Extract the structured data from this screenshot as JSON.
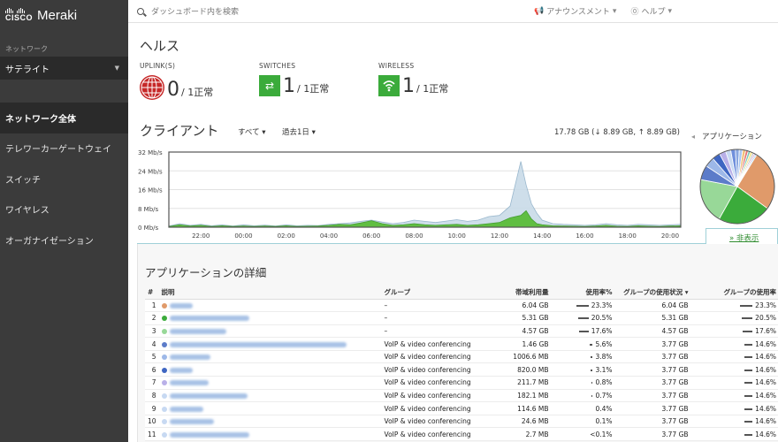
{
  "brand": {
    "cisco": "CISCO",
    "product": "Meraki"
  },
  "sidebar": {
    "section_label": "ネットワーク",
    "network": "サテライト",
    "items": [
      {
        "label": "ネットワーク全体",
        "active": true
      },
      {
        "label": "テレワーカーゲートウェイ",
        "active": false
      },
      {
        "label": "スイッチ",
        "active": false
      },
      {
        "label": "ワイヤレス",
        "active": false
      },
      {
        "label": "オーガナイゼーション",
        "active": false
      }
    ]
  },
  "topbar": {
    "search_placeholder": "ダッシュボード内を検索",
    "announcement": "アナウンスメント",
    "help": "ヘルプ"
  },
  "health": {
    "title": "ヘルス",
    "stats": [
      {
        "label": "UPLINK(S)",
        "count": "0",
        "detail": "/ 1正常",
        "icon": "globe-icon",
        "color": "#c62828"
      },
      {
        "label": "SWITCHES",
        "count": "1",
        "detail": "/ 1正常",
        "icon": "switch-icon",
        "color": "#3bab3b"
      },
      {
        "label": "WIRELESS",
        "count": "1",
        "detail": "/ 1正常",
        "icon": "wifi-icon",
        "color": "#3bab3b"
      }
    ]
  },
  "clients": {
    "title": "クライアント",
    "filter_all": "すべて",
    "filter_range": "過去1日",
    "usage_summary": "17.78 GB (↓ 8.89 GB, ↑ 8.89 GB)",
    "applications_label": "アプリケーション",
    "hide_link": "» 非表示"
  },
  "chart_data": {
    "type": "area",
    "y_ticks": [
      "32 Mb/s",
      "24 Mb/s",
      "16 Mb/s",
      "8 Mb/s",
      "0 Mb/s"
    ],
    "ylim": [
      0,
      32
    ],
    "x_ticks": [
      "22:00",
      "00:00",
      "02:00",
      "04:00",
      "06:00",
      "08:00",
      "10:00",
      "12:00",
      "14:00",
      "16:00",
      "18:00",
      "20:00"
    ],
    "x_hours": [
      20.5,
      21,
      21.5,
      22,
      22.5,
      23,
      23.5,
      24,
      24.5,
      25,
      25.5,
      26,
      26.5,
      27,
      27.5,
      28,
      28.5,
      29,
      29.5,
      30,
      30.5,
      31,
      31.5,
      32,
      32.5,
      33,
      33.5,
      34,
      34.5,
      35,
      35.5,
      36,
      36.5,
      37,
      37.25,
      37.5,
      37.75,
      38,
      38.5,
      39,
      39.5,
      40,
      40.5,
      41,
      41.5,
      42,
      42.5,
      43,
      43.5,
      44,
      44.5
    ],
    "series": [
      {
        "values": [
          0.5,
          1.5,
          0.8,
          1.2,
          0.6,
          1.0,
          0.5,
          1.0,
          0.6,
          0.9,
          0.5,
          1.0,
          0.6,
          0.8,
          0.7,
          1.2,
          1.5,
          1.8,
          2.5,
          3.0,
          2.2,
          1.5,
          2.0,
          3.0,
          2.5,
          2.0,
          2.6,
          3.2,
          2.5,
          3.0,
          4.5,
          5.0,
          9.0,
          28.0,
          18.0,
          10.0,
          6.0,
          3.0,
          1.5,
          1.2,
          1.0,
          0.8,
          1.0,
          1.5,
          1.0,
          0.8,
          1.2,
          1.0,
          0.8,
          1.0,
          1.2
        ]
      },
      {
        "values": [
          0.3,
          1.0,
          0.5,
          0.8,
          0.3,
          0.6,
          0.3,
          0.5,
          0.3,
          0.5,
          0.3,
          0.6,
          0.3,
          0.4,
          0.5,
          0.8,
          1.2,
          1.0,
          1.8,
          2.8,
          1.5,
          0.8,
          1.0,
          1.5,
          1.0,
          0.8,
          1.0,
          1.2,
          0.8,
          1.0,
          1.5,
          2.0,
          4.0,
          5.0,
          7.0,
          3.5,
          1.5,
          1.0,
          0.6,
          0.5,
          0.4,
          0.3,
          0.5,
          0.8,
          0.4,
          0.3,
          0.6,
          0.4,
          0.3,
          0.5,
          0.6
        ]
      }
    ],
    "colors": [
      "#c9dbe8",
      "#5bbd3a"
    ]
  },
  "pie_data": {
    "type": "pie",
    "values": [
      23.3,
      20.5,
      17.6,
      5.6,
      3.8,
      3.1,
      2.5,
      2.0,
      1.8,
      1.5,
      1.3,
      1.2,
      1.0,
      0.9,
      0.8,
      0.7,
      0.6,
      0.5
    ],
    "colors": [
      "#e09a6a",
      "#3bab3b",
      "#98d898",
      "#5c7cc9",
      "#9db8e8",
      "#3f66c2",
      "#b9b0e8",
      "#c7d9f2",
      "#6f8fdc",
      "#88a6e0",
      "#a9c6f0",
      "#f0c07a",
      "#e57373",
      "#7ac7b8",
      "#f2e27a",
      "#c0c0c0",
      "#d6a6d6",
      "#8fd0f0"
    ]
  },
  "details": {
    "title": "アプリケーションの詳細",
    "headers": [
      "#",
      "説明",
      "グループ",
      "帯域利用量",
      "使用率%",
      "グループの使用状況 ▾",
      "グループの使用率"
    ],
    "rows": [
      {
        "n": "1",
        "color": "#e09a6a",
        "w": 26,
        "group": "–",
        "usage": "6.04 GB",
        "pct": "23.3%",
        "bar": 14,
        "gusage": "6.04 GB",
        "gpct": "23.3%",
        "gbar": 14
      },
      {
        "n": "2",
        "color": "#3bab3b",
        "w": 90,
        "group": "–",
        "usage": "5.31 GB",
        "pct": "20.5%",
        "bar": 12,
        "gusage": "5.31 GB",
        "gpct": "20.5%",
        "gbar": 12
      },
      {
        "n": "3",
        "color": "#98d898",
        "w": 64,
        "group": "–",
        "usage": "4.57 GB",
        "pct": "17.6%",
        "bar": 11,
        "gusage": "4.57 GB",
        "gpct": "17.6%",
        "gbar": 11
      },
      {
        "n": "4",
        "color": "#5c7cc9",
        "w": 200,
        "group": "VoIP & video conferencing",
        "usage": "1.46 GB",
        "pct": "5.6%",
        "bar": 3,
        "gusage": "3.77 GB",
        "gpct": "14.6%",
        "gbar": 9
      },
      {
        "n": "5",
        "color": "#9db8e8",
        "w": 46,
        "group": "VoIP & video conferencing",
        "usage": "1006.6 MB",
        "pct": "3.8%",
        "bar": 2,
        "gusage": "3.77 GB",
        "gpct": "14.6%",
        "gbar": 9
      },
      {
        "n": "6",
        "color": "#3f66c2",
        "w": 26,
        "group": "VoIP & video conferencing",
        "usage": "820.0 MB",
        "pct": "3.1%",
        "bar": 2,
        "gusage": "3.77 GB",
        "gpct": "14.6%",
        "gbar": 9
      },
      {
        "n": "7",
        "color": "#b9b0e8",
        "w": 44,
        "group": "VoIP & video conferencing",
        "usage": "211.7 MB",
        "pct": "0.8%",
        "bar": 1,
        "gusage": "3.77 GB",
        "gpct": "14.6%",
        "gbar": 9
      },
      {
        "n": "8",
        "color": "#c7d9f2",
        "w": 88,
        "group": "VoIP & video conferencing",
        "usage": "182.1 MB",
        "pct": "0.7%",
        "bar": 1,
        "gusage": "3.77 GB",
        "gpct": "14.6%",
        "gbar": 9
      },
      {
        "n": "9",
        "color": "#c7d9f2",
        "w": 38,
        "group": "VoIP & video conferencing",
        "usage": "114.6 MB",
        "pct": "0.4%",
        "bar": 0,
        "gusage": "3.77 GB",
        "gpct": "14.6%",
        "gbar": 9
      },
      {
        "n": "10",
        "color": "#c7d9f2",
        "w": 50,
        "group": "VoIP & video conferencing",
        "usage": "24.6 MB",
        "pct": "0.1%",
        "bar": 0,
        "gusage": "3.77 GB",
        "gpct": "14.6%",
        "gbar": 9
      },
      {
        "n": "11",
        "color": "#c7d9f2",
        "w": 90,
        "group": "VoIP & video conferencing",
        "usage": "2.7 MB",
        "pct": "<0.1%",
        "bar": 0,
        "gusage": "3.77 GB",
        "gpct": "14.6%",
        "gbar": 9
      }
    ]
  }
}
